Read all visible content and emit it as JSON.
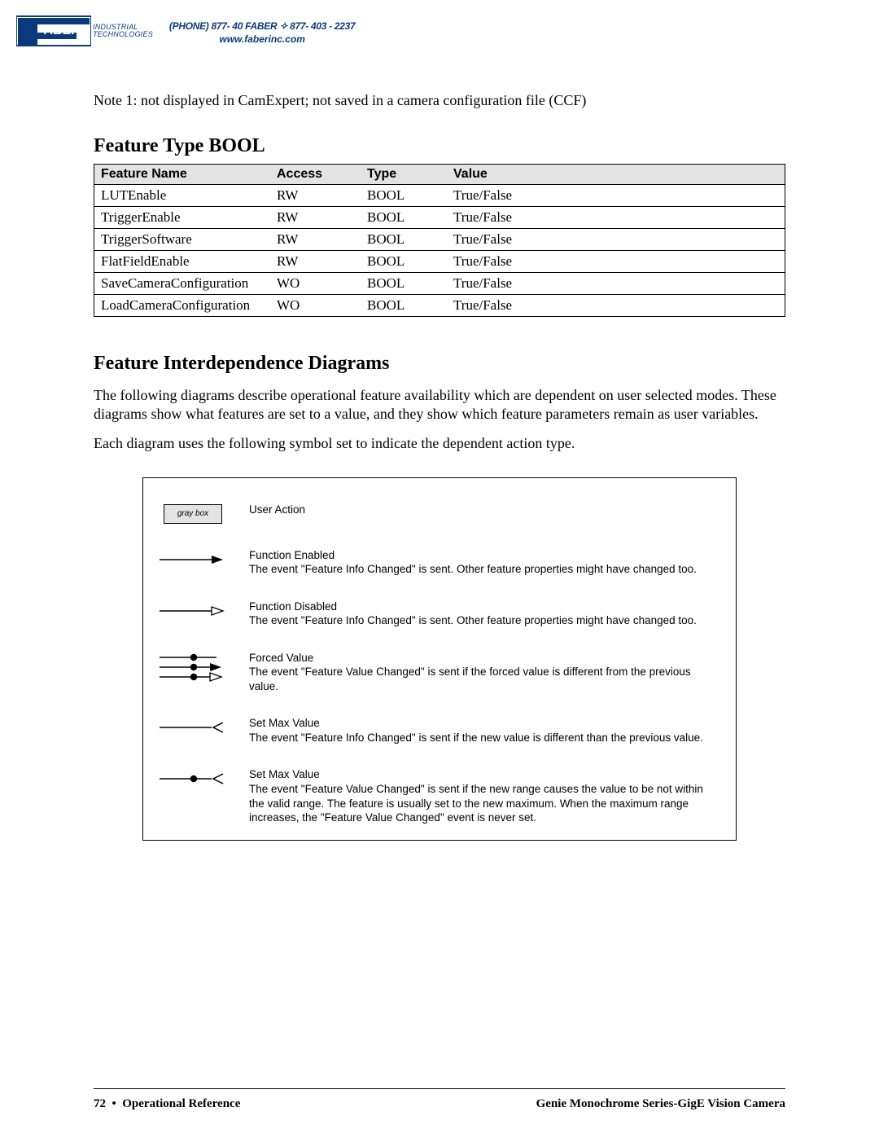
{
  "header": {
    "logo_brand": "FABER",
    "logo_sub1": "INDUSTRIAL",
    "logo_sub2": "TECHNOLOGIES",
    "phone": "(PHONE) 877- 40 FABER  ✧  877- 403 - 2237",
    "website": "www.faberinc.com"
  },
  "note": "Note 1: not displayed in CamExpert; not saved in a camera configuration file (CCF)",
  "section1_title": "Feature Type BOOL",
  "table": {
    "headers": {
      "name": "Feature Name",
      "access": "Access",
      "type": "Type",
      "value": "Value"
    },
    "rows": [
      {
        "name": "LUTEnable",
        "access": "RW",
        "type": "BOOL",
        "value": "True/False"
      },
      {
        "name": "TriggerEnable",
        "access": "RW",
        "type": "BOOL",
        "value": "True/False"
      },
      {
        "name": "TriggerSoftware",
        "access": "RW",
        "type": "BOOL",
        "value": "True/False"
      },
      {
        "name": "FlatFieldEnable",
        "access": "RW",
        "type": "BOOL",
        "value": "True/False"
      },
      {
        "name": "SaveCameraConfiguration",
        "access": "WO",
        "type": "BOOL",
        "value": "True/False"
      },
      {
        "name": "LoadCameraConfiguration",
        "access": "WO",
        "type": "BOOL",
        "value": "True/False"
      }
    ]
  },
  "section2_title": "Feature Interdependence Diagrams",
  "para1": "The following diagrams describe operational feature availability which are dependent on user selected modes. These diagrams show what features are set to a value, and they show which feature parameters remain as user variables.",
  "para2": "Each diagram uses the following symbol set to indicate the dependent action type.",
  "legend": {
    "greybox_label": "gray box",
    "rows": [
      {
        "title": "User Action",
        "desc": ""
      },
      {
        "title": "Function Enabled",
        "desc": "The event \"Feature Info Changed\" is sent. Other feature properties might have changed too."
      },
      {
        "title": "Function Disabled",
        "desc": "The event \"Feature Info Changed\" is sent. Other feature properties might have changed too."
      },
      {
        "title": "Forced Value",
        "desc": "The event \"Feature Value Changed\" is sent if the forced value is different from the previous value."
      },
      {
        "title": "Set Max Value",
        "desc": "The event \"Feature Info Changed\" is sent if the new value is different than the previous value."
      },
      {
        "title": "Set Max Value",
        "desc": "The event \"Feature Value Changed\" is sent if the new range causes the value to be not within the valid range. The feature is usually set to the new maximum. When the maximum range increases, the \"Feature Value Changed\" event is never set."
      }
    ]
  },
  "footer": {
    "page": "72",
    "bullet": "•",
    "left": "Operational Reference",
    "right": "Genie Monochrome Series-GigE Vision Camera"
  }
}
